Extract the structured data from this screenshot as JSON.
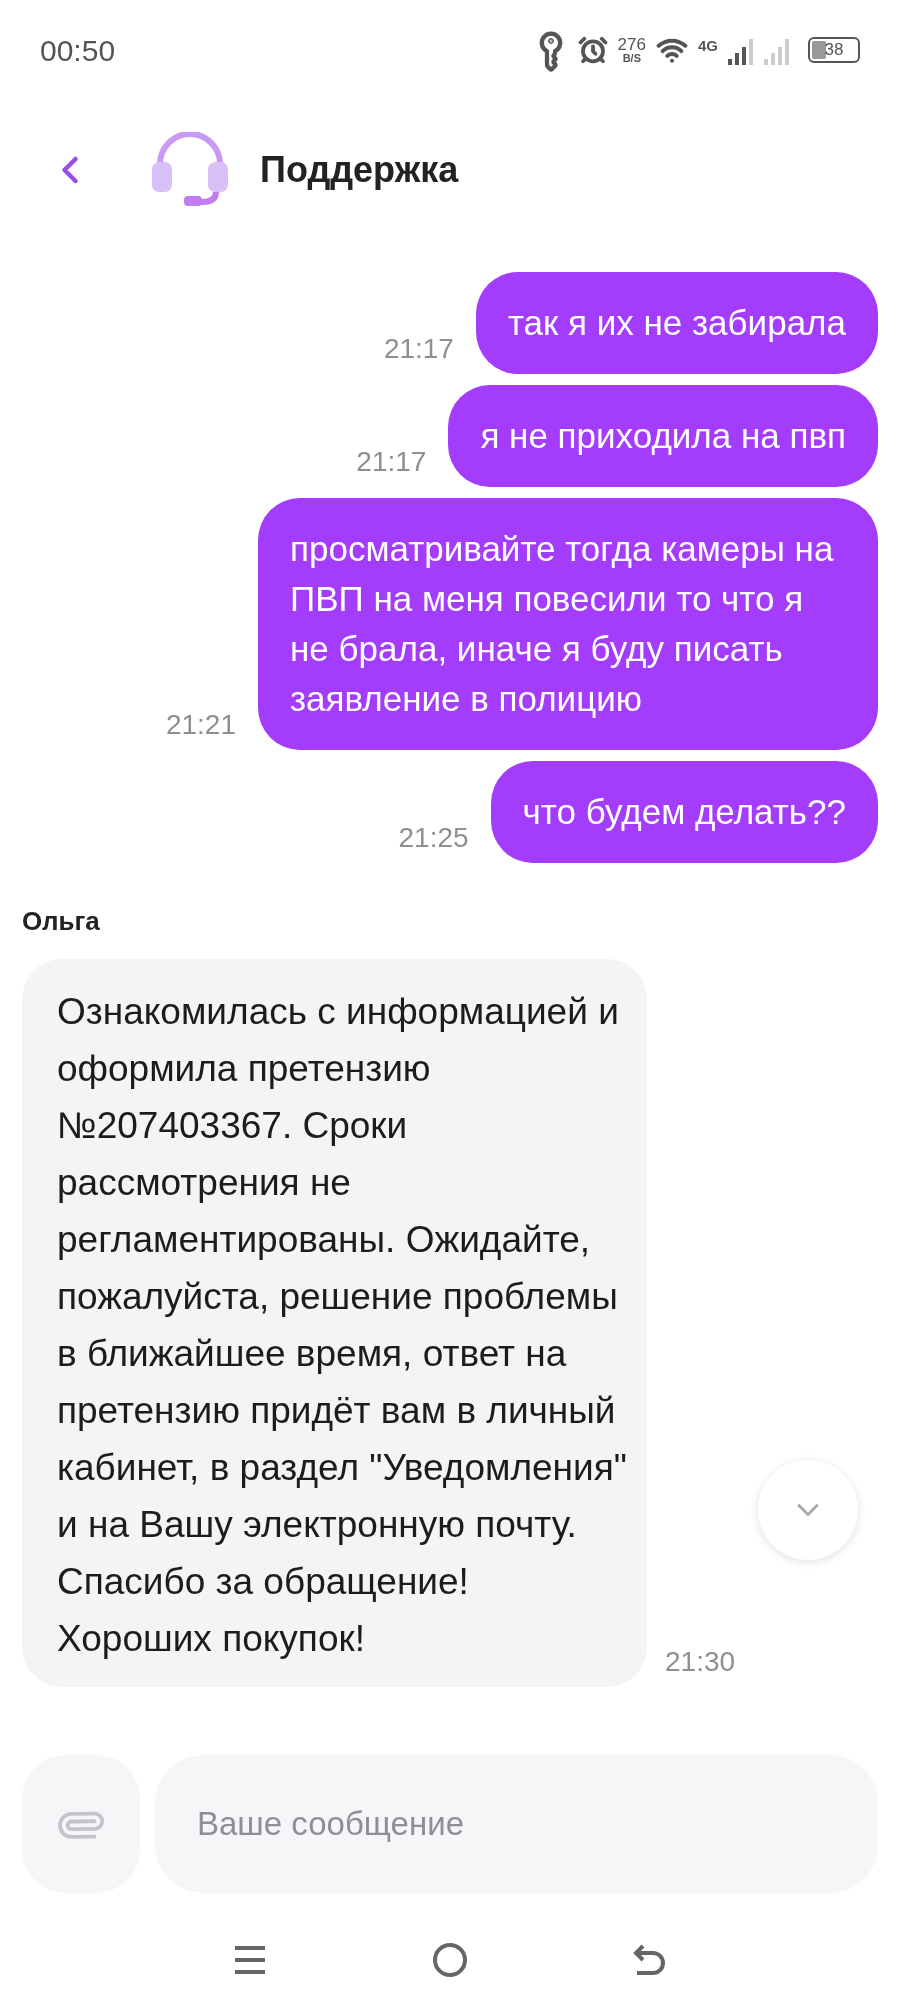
{
  "status_bar": {
    "time": "00:50",
    "net_speed": "276",
    "net_unit": "B/S",
    "network": "4G",
    "battery": "38"
  },
  "header": {
    "title": "Поддержка"
  },
  "messages": [
    {
      "kind": "outgoing",
      "text": "так я их не забирала",
      "time": "21:17"
    },
    {
      "kind": "outgoing",
      "text": "я не приходила на пвп",
      "time": "21:17"
    },
    {
      "kind": "outgoing",
      "text": "просматривайте тогда камеры на ПВП на меня повесили то что я не брала, иначе я буду писать заявление в полицию",
      "time": "21:21"
    },
    {
      "kind": "outgoing",
      "text": "что будем делать??",
      "time": "21:25"
    },
    {
      "kind": "incoming",
      "sender": "Ольга",
      "text": "Ознакомилась с информацией и оформила претензию №207403367. Сроки рассмотрения не регламентированы. Ожидайте, пожалуйста, решение проблемы в ближайшее время, ответ на претензию придёт вам в личный кабинет, в раздел \"Уведомления\" и на Вашу электронную почту. Спасибо за обращение! Хороших покупок!",
      "time": "21:30"
    }
  ],
  "composer": {
    "placeholder": "Ваше сообщение"
  }
}
